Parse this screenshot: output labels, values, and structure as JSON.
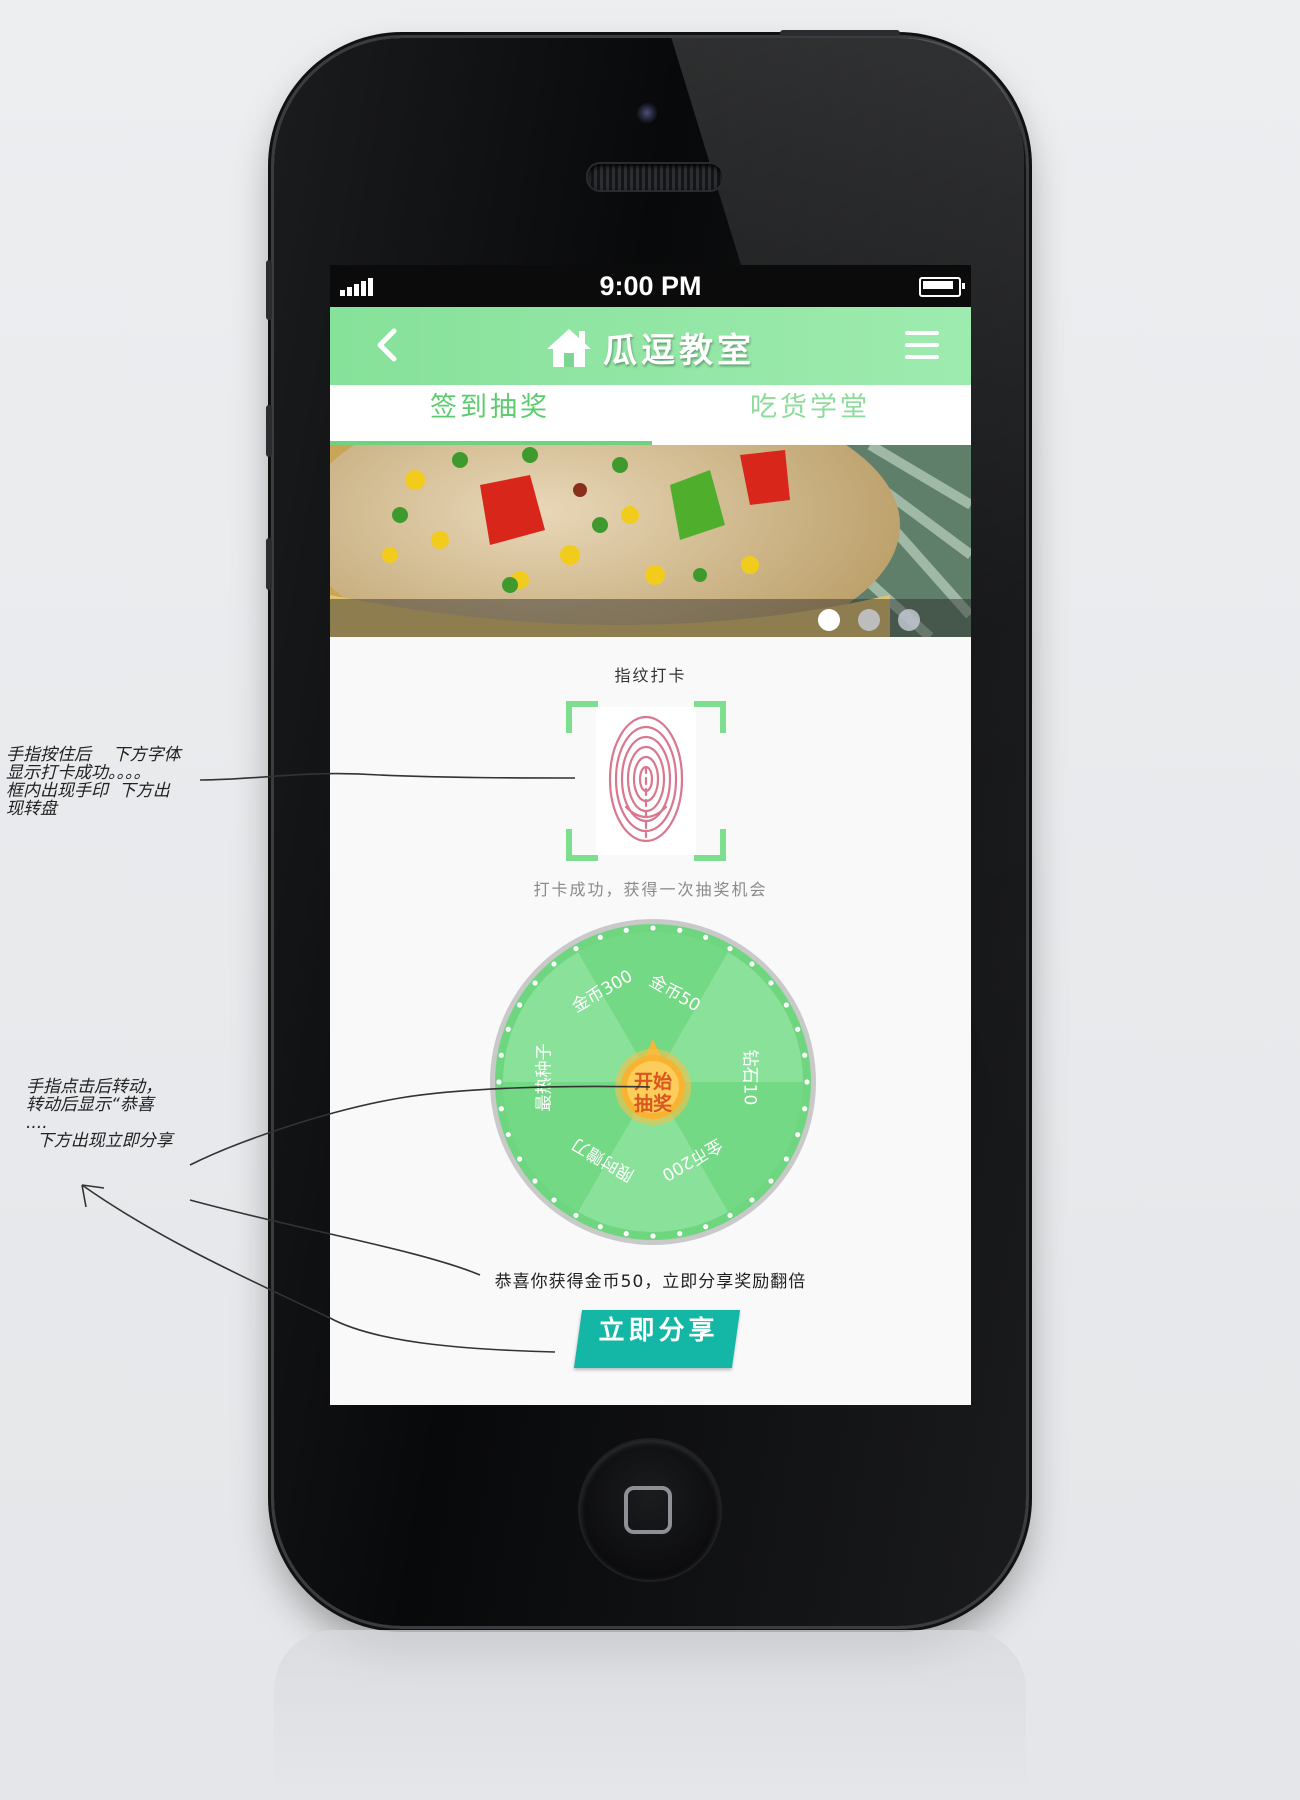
{
  "status_bar": {
    "time": "9:00 PM"
  },
  "header": {
    "title": "瓜逗教室"
  },
  "tabs": [
    {
      "label": "签到抽奖",
      "active": true
    },
    {
      "label": "吃货学堂",
      "active": false
    }
  ],
  "carousel": {
    "page_count": 3,
    "active_index": 0
  },
  "checkin": {
    "title": "指纹打卡",
    "status": "打卡成功，获得一次抽奖机会"
  },
  "wheel": {
    "prizes": [
      "金币50",
      "钻石10",
      "金币200",
      "限时赠刀",
      "最热种子",
      "金币300"
    ],
    "start_label": [
      "开始",
      "抽奖"
    ]
  },
  "result": {
    "message": "恭喜你获得金币50，立即分享奖励翻倍",
    "share_label": "立即分享"
  },
  "annotations": [
    "手指按住后    下方字体\n显示打卡成功。。。。\n框内出现手印  下方出\n现转盘",
    "手指点击后转动，\n转动后显示“恭喜\n....\n  下方出现立即分享"
  ],
  "colors": {
    "nav_green": "#86e199",
    "tab_green": "#5dcc6e",
    "wheel_green": "#6fd680",
    "share_teal": "#14b6a6"
  }
}
